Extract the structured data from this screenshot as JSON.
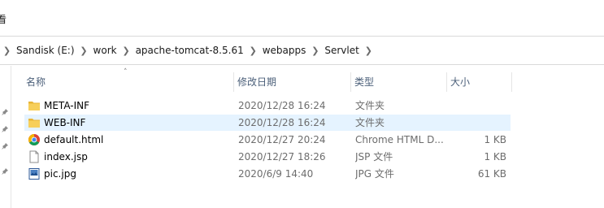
{
  "menu_fragment": "看",
  "address": {
    "crumbs": [
      "Sandisk (E:)",
      "work",
      "apache-tomcat-8.5.61",
      "webapps",
      "Servlet"
    ]
  },
  "columns": {
    "name": "名称",
    "date": "修改日期",
    "type": "类型",
    "size": "大小",
    "sorted_by": "名称"
  },
  "files": [
    {
      "name": "META-INF",
      "date": "2020/12/28 16:24",
      "type": "文件夹",
      "size": "",
      "icon": "folder-icon",
      "selected": false
    },
    {
      "name": "WEB-INF",
      "date": "2020/12/28 16:24",
      "type": "文件夹",
      "size": "",
      "icon": "folder-icon",
      "selected": true
    },
    {
      "name": "default.html",
      "date": "2020/12/27 20:24",
      "type": "Chrome HTML D...",
      "size": "1 KB",
      "icon": "chrome-icon",
      "selected": false
    },
    {
      "name": "index.jsp",
      "date": "2020/12/27 18:26",
      "type": "JSP 文件",
      "size": "1 KB",
      "icon": "file-icon",
      "selected": false
    },
    {
      "name": "pic.jpg",
      "date": "2020/6/9 14:40",
      "type": "JPG 文件",
      "size": "61 KB",
      "icon": "image-icon",
      "selected": false
    }
  ],
  "colors": {
    "selection": "#e5f3ff",
    "header_text": "#4c607a",
    "meta_text": "#6d6d6d",
    "folder": "#f3c54b"
  }
}
